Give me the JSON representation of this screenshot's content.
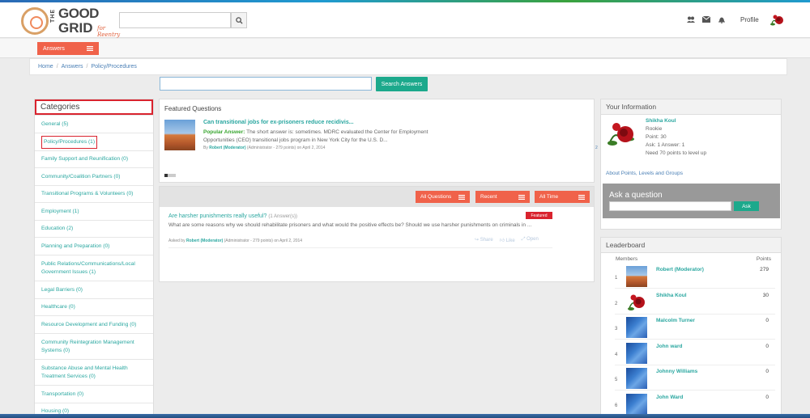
{
  "header": {
    "logo_the": "THE",
    "logo_good": "GOOD",
    "logo_grid": "GRID",
    "logo_reentry": "for Reentry",
    "search_placeholder": "",
    "profile_label": "Profile",
    "icons": [
      "users-icon",
      "envelope-icon",
      "bell-icon"
    ]
  },
  "subnav": {
    "answers_label": "Answers"
  },
  "breadcrumb": [
    "Home",
    "Answers",
    "Policy/Procedures"
  ],
  "search": {
    "placeholder": "",
    "button_label": "Search Answers"
  },
  "categories": {
    "title": "Categories",
    "items": [
      {
        "label": "General (5)",
        "h": 22
      },
      {
        "label": "Policy/Procedures (1)",
        "h": 22,
        "active": true
      },
      {
        "label": "Family Support and Reunification (0)",
        "h": 21
      },
      {
        "label": "Community/Coalition Partners (0)",
        "h": 22
      },
      {
        "label": "Transitional Programs & Volunteers (0)",
        "h": 21
      },
      {
        "label": "Employment (1)",
        "h": 22
      },
      {
        "label": "Education (2)",
        "h": 21
      },
      {
        "label": "Planning and Preparation (0)",
        "h": 22
      },
      {
        "label": "Public Relations/Communications/Local Government Issues (1)",
        "h": 32
      },
      {
        "label": "Legal Barriers (0)",
        "h": 22
      },
      {
        "label": "Healthcare (0)",
        "h": 21
      },
      {
        "label": "Resource Development and Funding (0)",
        "h": 22
      },
      {
        "label": "Community Reintegration Management Systems (0)",
        "h": 32
      },
      {
        "label": "Substance Abuse and Mental Health Treatment Services (0)",
        "h": 32
      },
      {
        "label": "Transportation (0)",
        "h": 22
      },
      {
        "label": "Housing (0)",
        "h": 21
      }
    ]
  },
  "featured": {
    "title": "Featured Questions",
    "question": "Can transitional jobs for ex-prisoners reduce recidivis...",
    "answer_label": "Popular Answer:",
    "answer_text": " The short answer is: sometimes. MDRC evaluated the Center for Employment Opportunities (CEO) transitional jobs program in New York City for the U.S. D...",
    "meta_by": "By",
    "meta_author": "Robert (Moderator)",
    "meta_rest": "(Administrator - 279 points)   on April 2, 2014",
    "count": "2"
  },
  "questions": {
    "filters": [
      "All Questions",
      "Recent",
      "All Time"
    ],
    "items": [
      {
        "title": "Are harsher punishments really useful?",
        "answers": "(1 Answer(s))",
        "badge": "Featured",
        "body": "What are some reasons why we should rehabilitate prisoners and what would the positive effects be? Should we use harsher punishments on criminals in ...",
        "meta_by": "Asked by",
        "meta_author": "Robert (Moderator)",
        "meta_rest": "(Administrator - 279 points)   on April 2, 2014",
        "actions": [
          "Share",
          "Like",
          "Open"
        ]
      }
    ]
  },
  "your_info": {
    "title": "Your Information",
    "name": "Shikha Koul",
    "rank": "Rookie",
    "points": "Point: 30",
    "ask_answer": "Ask: 1    Answer: 1",
    "level": "Need 70 points to level up",
    "about": "About Points, Levels and Groups",
    "ask_title": "Ask a question",
    "ask_button": "Ask"
  },
  "leaderboard": {
    "title": "Leaderboard",
    "col_members": "Members",
    "col_points": "Points",
    "rows": [
      {
        "rank": "1",
        "name": "Robert (Moderator)",
        "points": "279",
        "avatar": "rock"
      },
      {
        "rank": "2",
        "name": "Shikha Koul",
        "points": "30",
        "avatar": "rose"
      },
      {
        "rank": "3",
        "name": "Malcolm Turner",
        "points": "0",
        "avatar": "blue"
      },
      {
        "rank": "4",
        "name": "John ward",
        "points": "0",
        "avatar": "blue"
      },
      {
        "rank": "5",
        "name": "Johnny Williams",
        "points": "0",
        "avatar": "blue"
      },
      {
        "rank": "6",
        "name": "John Ward",
        "points": "0",
        "avatar": "blue"
      }
    ]
  },
  "colors": {
    "accent_orange": "#f0624a",
    "accent_teal": "#1ca98c",
    "link_teal": "#2aa7a0",
    "highlight_red": "#d9232e"
  }
}
